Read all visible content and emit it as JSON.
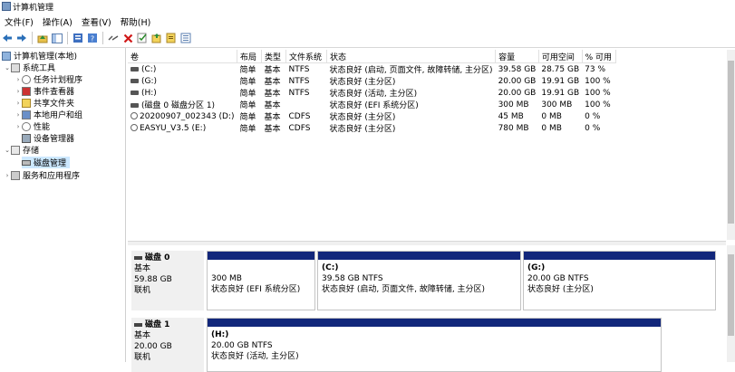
{
  "app": {
    "title": "计算机管理"
  },
  "menu": [
    "文件(F)",
    "操作(A)",
    "查看(V)",
    "帮助(H)"
  ],
  "toolbar_icons": [
    "back-arrow-icon",
    "forward-arrow-icon",
    "up-folder-icon",
    "console-tree-icon",
    "properties-icon",
    "help-icon",
    "connect-icon",
    "delete-icon",
    "check-icon",
    "export-icon",
    "import-icon",
    "list-icon"
  ],
  "tree": {
    "root": "计算机管理(本地)",
    "system_tools": "系统工具",
    "task_scheduler": "任务计划程序",
    "event_viewer": "事件查看器",
    "shared_folders": "共享文件夹",
    "local_users": "本地用户和组",
    "performance": "性能",
    "device_manager": "设备管理器",
    "storage": "存储",
    "disk_management": "磁盘管理",
    "services": "服务和应用程序"
  },
  "volumes": {
    "headers": [
      "卷",
      "布局",
      "类型",
      "文件系统",
      "状态",
      "容量",
      "可用空间",
      "% 可用"
    ],
    "rows": [
      {
        "icon": "drive",
        "name": "(C:)",
        "layout": "简单",
        "type": "基本",
        "fs": "NTFS",
        "status": "状态良好 (启动, 页面文件, 故障转储, 主分区)",
        "capacity": "39.58 GB",
        "free": "28.75 GB",
        "pct": "73 %"
      },
      {
        "icon": "drive",
        "name": "(G:)",
        "layout": "简单",
        "type": "基本",
        "fs": "NTFS",
        "status": "状态良好 (主分区)",
        "capacity": "20.00 GB",
        "free": "19.91 GB",
        "pct": "100 %"
      },
      {
        "icon": "drive",
        "name": "(H:)",
        "layout": "简单",
        "type": "基本",
        "fs": "NTFS",
        "status": "状态良好 (活动, 主分区)",
        "capacity": "20.00 GB",
        "free": "19.91 GB",
        "pct": "100 %"
      },
      {
        "icon": "drive",
        "name": "(磁盘 0 磁盘分区 1)",
        "layout": "简单",
        "type": "基本",
        "fs": "",
        "status": "状态良好 (EFI 系统分区)",
        "capacity": "300 MB",
        "free": "300 MB",
        "pct": "100 %"
      },
      {
        "icon": "cd",
        "name": "20200907_002343 (D:)",
        "layout": "简单",
        "type": "基本",
        "fs": "CDFS",
        "status": "状态良好 (主分区)",
        "capacity": "45 MB",
        "free": "0 MB",
        "pct": "0 %"
      },
      {
        "icon": "cd",
        "name": "EASYU_V3.5 (E:)",
        "layout": "简单",
        "type": "基本",
        "fs": "CDFS",
        "status": "状态良好 (主分区)",
        "capacity": "780 MB",
        "free": "0 MB",
        "pct": "0 %"
      }
    ]
  },
  "disks": [
    {
      "name": "磁盘 0",
      "type": "基本",
      "size": "59.88 GB",
      "state": "联机",
      "partitions": [
        {
          "label": "",
          "size": "300 MB",
          "status": "状态良好 (EFI 系统分区)"
        },
        {
          "label": "(C:)",
          "size": "39.58 GB NTFS",
          "status": "状态良好 (启动, 页面文件, 故障转储, 主分区)"
        },
        {
          "label": "(G:)",
          "size": "20.00 GB NTFS",
          "status": "状态良好 (主分区)"
        }
      ]
    },
    {
      "name": "磁盘 1",
      "type": "基本",
      "size": "20.00 GB",
      "state": "联机",
      "partitions": [
        {
          "label": "(H:)",
          "size": "20.00 GB NTFS",
          "status": "状态良好 (活动, 主分区)"
        }
      ]
    }
  ],
  "colors": {
    "partition_bar": "#12277b",
    "selection": "#cce8ff"
  }
}
